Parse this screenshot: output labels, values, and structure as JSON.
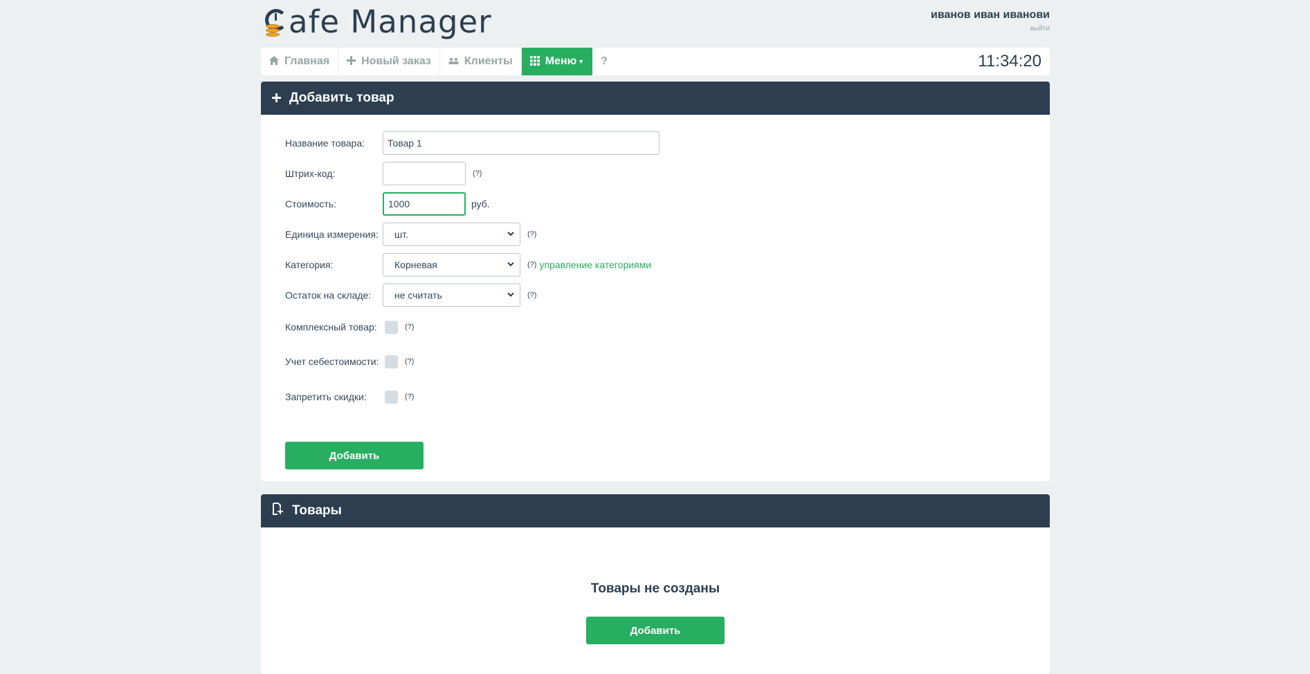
{
  "app": {
    "logo_text": "afe Manager"
  },
  "user": {
    "name": "иванов иван иванови",
    "logout_label": "выйти"
  },
  "nav": {
    "items": [
      {
        "label": "Главная",
        "icon": "home-icon"
      },
      {
        "label": "Новый заказ",
        "icon": "plus-icon"
      },
      {
        "label": "Клиенты",
        "icon": "users-icon"
      },
      {
        "label": "Меню",
        "icon": "grid-icon"
      },
      {
        "label": "?"
      }
    ],
    "clock": "11:34:20"
  },
  "add_panel": {
    "title": "Добавить товар",
    "fields": {
      "name_label": "Название товара:",
      "name_value": "Товар 1",
      "barcode_label": "Штрих-код:",
      "barcode_value": "",
      "barcode_hint": "(?)",
      "price_label": "Стоимость:",
      "price_value": "1000",
      "price_unit": "руб.",
      "unit_label": "Единица измерения:",
      "unit_value": "шт.",
      "unit_hint": "(?)",
      "category_label": "Категория:",
      "category_value": "Корневая",
      "category_hint": "(?)",
      "category_link": "управление категориями",
      "stock_label": "Остаток на складе:",
      "stock_value": "не считать",
      "stock_hint": "(?)",
      "complex_label": "Комплексный товар:",
      "complex_hint": "(?)",
      "cost_label": "Учет себестоимости:",
      "cost_hint": "(?)",
      "discount_label": "Запретить скидки:",
      "discount_hint": "(?)"
    },
    "submit_label": "Добавить"
  },
  "products_panel": {
    "title": "Товары",
    "empty_text": "Товары не созданы",
    "add_label": "Добавить"
  },
  "colors": {
    "accent": "#27ae60",
    "header_bg": "#2c3e50",
    "page_bg": "#ecf0f1"
  }
}
